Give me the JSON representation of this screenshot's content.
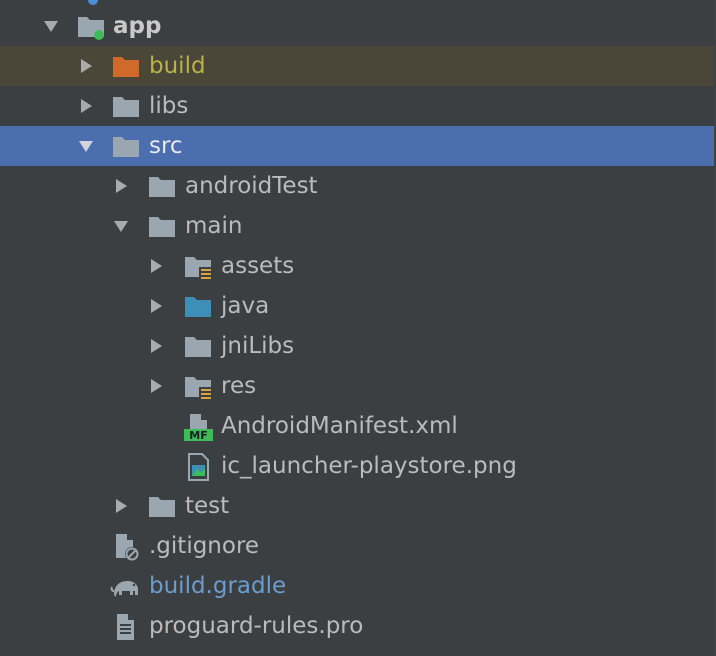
{
  "tree": {
    "items": [
      {
        "label": "app",
        "kind": "module"
      },
      {
        "label": "build",
        "kind": "excluded-folder"
      },
      {
        "label": "libs",
        "kind": "folder"
      },
      {
        "label": "src",
        "kind": "folder"
      },
      {
        "label": "androidTest",
        "kind": "folder"
      },
      {
        "label": "main",
        "kind": "folder"
      },
      {
        "label": "assets",
        "kind": "resource-folder"
      },
      {
        "label": "java",
        "kind": "source-folder"
      },
      {
        "label": "jniLibs",
        "kind": "folder"
      },
      {
        "label": "res",
        "kind": "resource-folder"
      },
      {
        "label": "AndroidManifest.xml",
        "kind": "manifest-file",
        "badge": "MF"
      },
      {
        "label": "ic_launcher-playstore.png",
        "kind": "image-file"
      },
      {
        "label": "test",
        "kind": "folder"
      },
      {
        "label": ".gitignore",
        "kind": "ignored-file"
      },
      {
        "label": "build.gradle",
        "kind": "gradle-file"
      },
      {
        "label": "proguard-rules.pro",
        "kind": "text-file"
      }
    ]
  },
  "colors": {
    "background": "#3c3f41",
    "selection": "#4b6eaf",
    "excluded_row": "#4a4738",
    "folder": "#9aa7b0",
    "excluded_folder": "#d06a2b",
    "source_folder": "#3d8fb7",
    "gradle_text": "#6b9ccf",
    "excluded_text": "#b8b34a",
    "module_dot": "#3dbd5a"
  }
}
